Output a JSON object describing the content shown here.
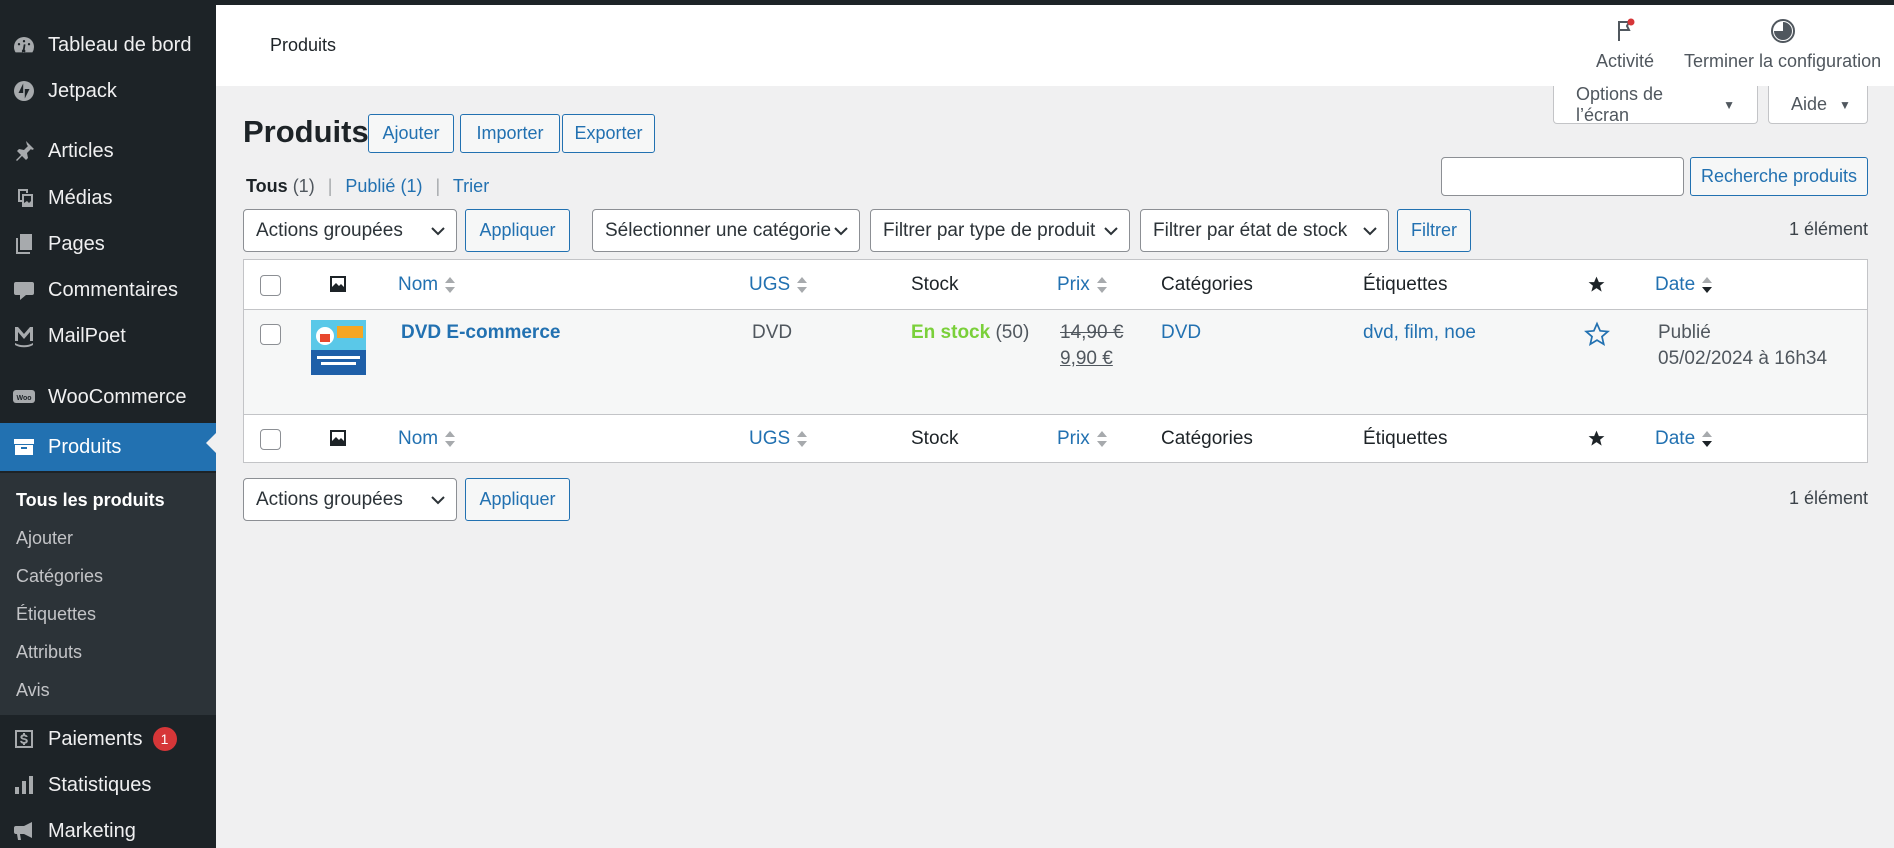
{
  "sidebar": {
    "items": [
      {
        "label": "Tableau de bord",
        "icon": "dashboard-icon"
      },
      {
        "label": "Jetpack",
        "icon": "jetpack-icon"
      },
      {
        "label": "Articles",
        "icon": "pin-icon"
      },
      {
        "label": "Médias",
        "icon": "media-icon"
      },
      {
        "label": "Pages",
        "icon": "pages-icon"
      },
      {
        "label": "Commentaires",
        "icon": "comment-icon"
      },
      {
        "label": "MailPoet",
        "icon": "mailpoet-icon"
      },
      {
        "label": "WooCommerce",
        "icon": "woocommerce-icon"
      },
      {
        "label": "Produits",
        "icon": "archive-icon",
        "active": true
      }
    ],
    "submenu": [
      "Tous les produits",
      "Ajouter",
      "Catégories",
      "Étiquettes",
      "Attributs",
      "Avis"
    ],
    "bottom_items": [
      {
        "label": "Paiements",
        "icon": "payment-icon",
        "badge": "1"
      },
      {
        "label": "Statistiques",
        "icon": "chart-bar-icon"
      },
      {
        "label": "Marketing",
        "icon": "megaphone-icon"
      }
    ]
  },
  "header": {
    "title": "Produits",
    "activity_label": "Activité",
    "setup_label": "Terminer la configuration"
  },
  "screen_options": {
    "label": "Options de l’écran",
    "help": "Aide"
  },
  "page": {
    "title": "Produits",
    "buttons": {
      "add": "Ajouter",
      "import": "Importer",
      "export": "Exporter"
    },
    "views": {
      "all": "Tous",
      "all_count": "(1)",
      "published": "Publié",
      "published_count": "(1)",
      "sort": "Trier"
    },
    "search": {
      "value": "",
      "button": "Recherche produits"
    },
    "filters": {
      "bulk": "Actions groupées",
      "apply": "Appliquer",
      "category": "Sélectionner une catégorie",
      "type": "Filtrer par type de produit",
      "stock": "Filtrer par état de stock",
      "filter_button": "Filtrer"
    },
    "item_count": "1 élément"
  },
  "table": {
    "columns": {
      "name": "Nom",
      "sku": "UGS",
      "stock": "Stock",
      "price": "Prix",
      "categories": "Catégories",
      "tags": "Étiquettes",
      "date": "Date"
    },
    "rows": [
      {
        "name": "DVD E-commerce",
        "sku": "DVD",
        "stock_status": "En stock",
        "stock_qty": "(50)",
        "price_regular": "14,90 €",
        "price_sale": "9,90 €",
        "category": "DVD",
        "tags": "dvd, film, noe",
        "date_status": "Publié",
        "date": "05/02/2024 à 16h34"
      }
    ]
  },
  "colors": {
    "accent": "#2271b1",
    "sidebar": "#1d2327",
    "in_stock": "#7ad03a",
    "badge": "#d63638"
  }
}
